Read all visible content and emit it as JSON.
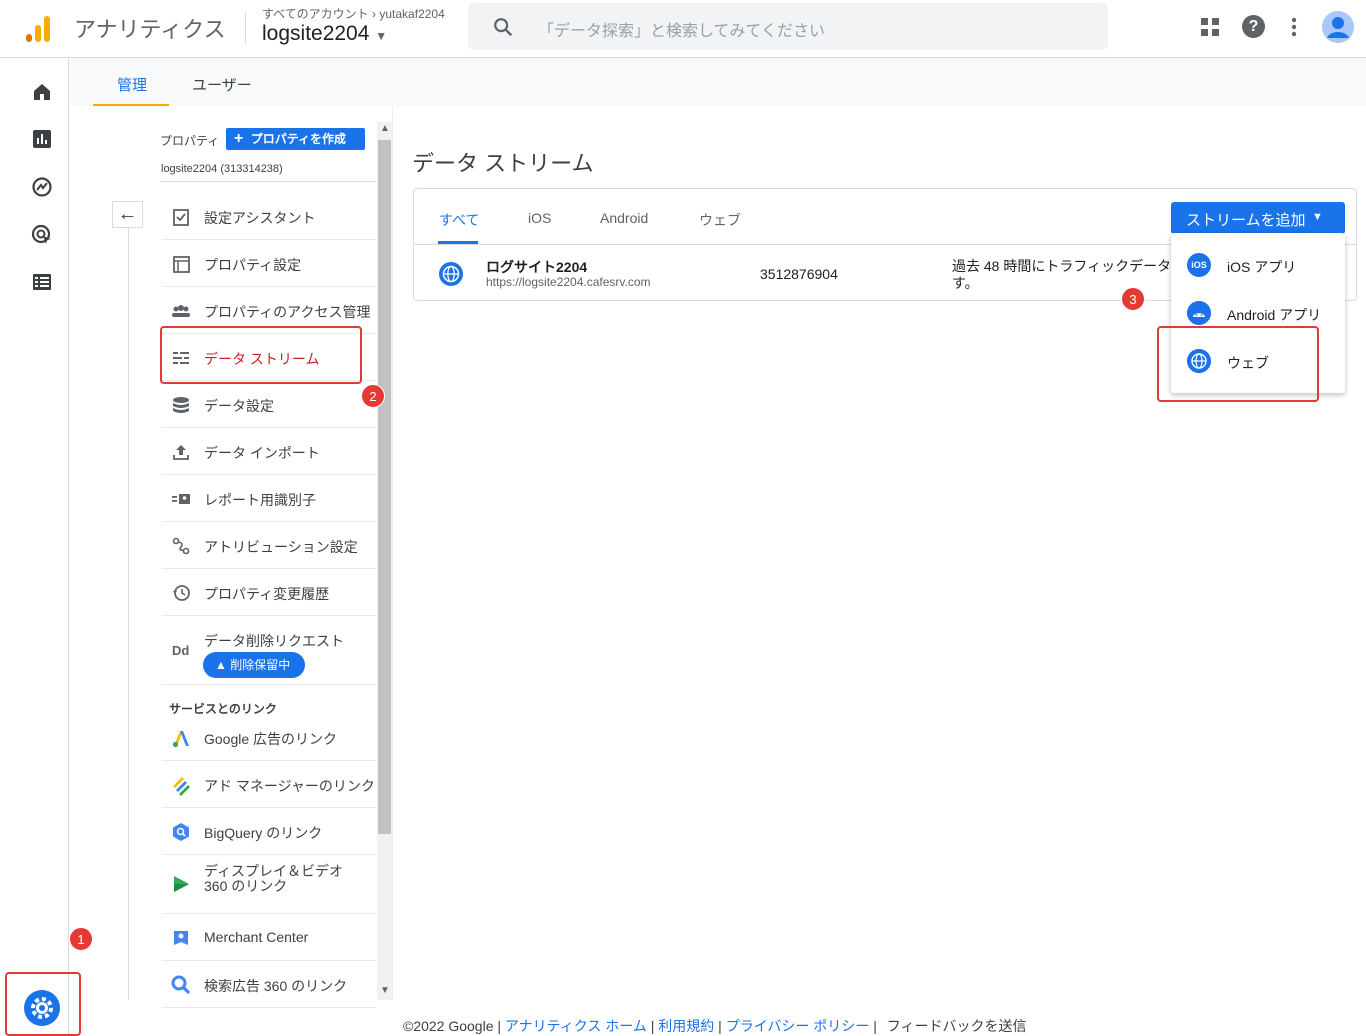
{
  "header": {
    "app_name": "アナリティクス",
    "breadcrumb_root": "すべてのアカウント",
    "breadcrumb_account": "yutakaf2204",
    "property_name": "logsite2204",
    "search_placeholder": "「データ探索」と検索してみてください"
  },
  "admin_tabs": [
    "管理",
    "ユーザー"
  ],
  "property_panel": {
    "label": "プロパティ",
    "create_button": "プロパティを作成",
    "property_id_text": "logsite2204 (313314238)"
  },
  "nav_items": [
    {
      "label": "設定アシスタント",
      "icon": "checklist-icon"
    },
    {
      "label": "プロパティ設定",
      "icon": "property-settings-icon"
    },
    {
      "label": "プロパティのアクセス管理",
      "icon": "people-icon"
    },
    {
      "label": "データ ストリーム",
      "icon": "data-stream-icon"
    },
    {
      "label": "データ設定",
      "icon": "database-icon"
    },
    {
      "label": "データ インポート",
      "icon": "upload-icon"
    },
    {
      "label": "レポート用識別子",
      "icon": "identifier-icon"
    },
    {
      "label": "アトリビューション設定",
      "icon": "attribution-icon"
    },
    {
      "label": "プロパティ変更履歴",
      "icon": "history-icon"
    }
  ],
  "data_deletion": {
    "label": "データ削除リクエスト",
    "badge": "削除保留中",
    "icon_text": "Dd"
  },
  "links_section": {
    "heading": "サービスとのリンク",
    "items": [
      {
        "label": "Google 広告のリンク",
        "icon": "google-ads-icon"
      },
      {
        "label": "アド マネージャーのリンク",
        "icon": "ad-manager-icon"
      },
      {
        "label": "BigQuery のリンク",
        "icon": "bigquery-icon"
      },
      {
        "label": "ディスプレイ＆ビデオ 360 のリンク",
        "icon": "dv360-icon"
      },
      {
        "label": "Merchant Center",
        "icon": "merchant-center-icon"
      },
      {
        "label": "検索広告 360 のリンク",
        "icon": "search-ads-icon"
      }
    ]
  },
  "main": {
    "title": "データ ストリーム",
    "tabs": [
      "すべて",
      "iOS",
      "Android",
      "ウェブ"
    ],
    "add_button": "ストリームを追加",
    "stream": {
      "name": "ログサイト2204",
      "url": "https://logsite2204.cafesrv.com",
      "id": "3512876904",
      "status_line1": "過去 48 時間にトラフィックデータ",
      "status_line2": "す。"
    },
    "dropdown": [
      {
        "label": "iOS アプリ",
        "icon": "ios-icon"
      },
      {
        "label": "Android アプリ",
        "icon": "android-icon"
      },
      {
        "label": "ウェブ",
        "icon": "web-globe-icon"
      }
    ]
  },
  "annotations": [
    "1",
    "2",
    "3"
  ],
  "footer": {
    "copyright": "©2022 Google",
    "links": [
      "アナリティクス ホーム",
      "利用規約",
      "プライバシー ポリシー"
    ],
    "feedback": "フィードバックを送信"
  },
  "colors": {
    "accent": "#1a73e8",
    "selected": "#c5221f",
    "annotation": "#e53935",
    "logo_orange": "#f9ab00",
    "logo_dark": "#e37400"
  }
}
